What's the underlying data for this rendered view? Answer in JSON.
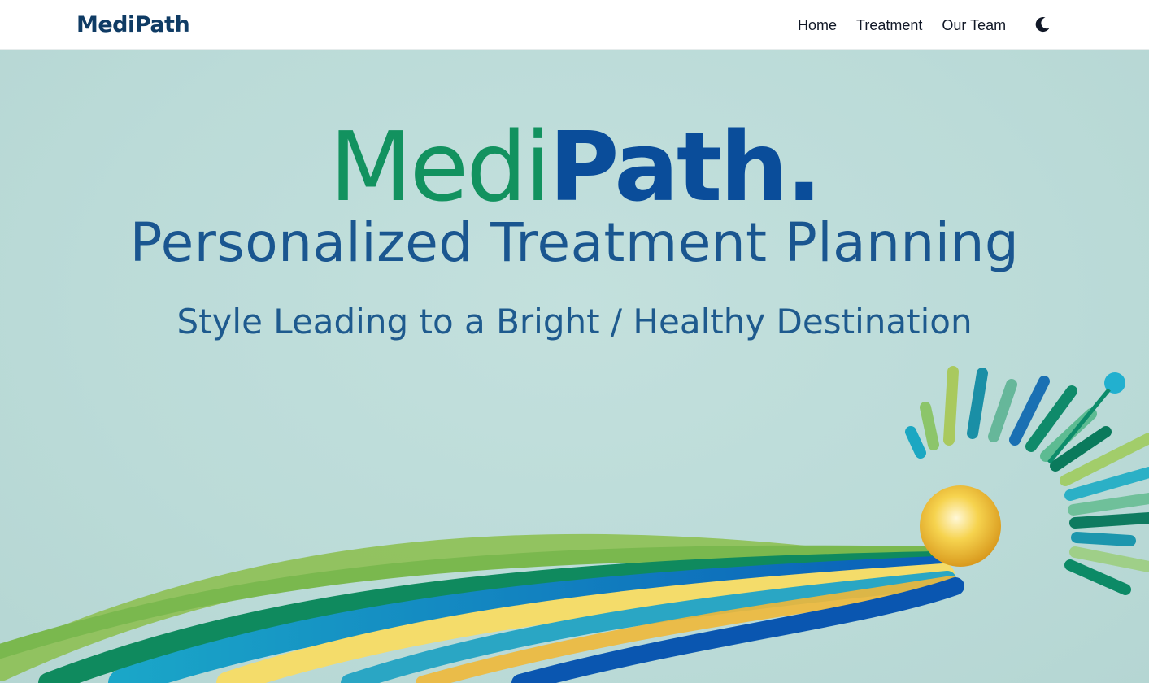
{
  "nav": {
    "brand": "MediPath",
    "links": [
      "Home",
      "Treatment",
      "Our Team"
    ],
    "theme_toggle_icon": "moon-icon"
  },
  "hero": {
    "logo_part1": "Medi",
    "logo_part2": "Path",
    "logo_dot": ".",
    "title": "Personalized Treatment Planning",
    "subtitle": "Style Leading to a Bright / Healthy Destination",
    "colors": {
      "background": "#bddcd9",
      "medi": "#12925f",
      "path": "#0a4d9a",
      "title": "#1a5690",
      "sun": "#f3c43a"
    }
  }
}
